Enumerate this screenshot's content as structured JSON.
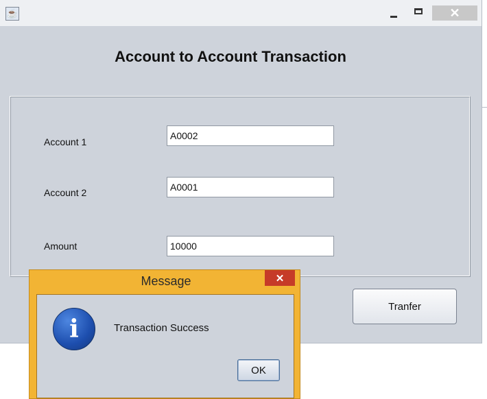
{
  "window": {
    "app_icon_glyph": "☕",
    "close_glyph": "✕"
  },
  "form": {
    "heading": "Account to Account Transaction",
    "account1_label": "Account 1",
    "account1_value": "A0002",
    "account2_label": "Account 2",
    "account2_value": "A0001",
    "amount_label": "Amount",
    "amount_value": "10000",
    "transfer_button": "Tranfer"
  },
  "dialog": {
    "title": "Message",
    "close_glyph": "✕",
    "icon": "info-icon",
    "icon_glyph": "i",
    "message": "Transaction Success",
    "ok_button": "OK"
  },
  "colors": {
    "window_bg": "#ced3db",
    "dialog_frame": "#f2b434",
    "dialog_close": "#c63b28",
    "info_icon": "#1d4eae"
  }
}
